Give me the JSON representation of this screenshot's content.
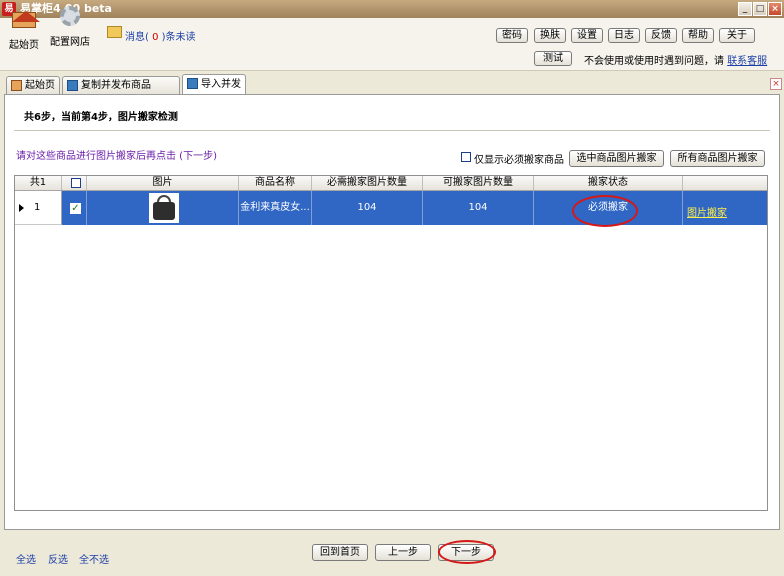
{
  "window": {
    "title": "易掌柜4.00 beta",
    "app_icon_glyph": "易"
  },
  "toolbar": {
    "home_label": "起始页",
    "config_label": "配置网店",
    "message": {
      "prefix": "消息(",
      "count": "0",
      "suffix": ")条未读"
    },
    "buttons": [
      "密码",
      "换肤",
      "设置",
      "日志",
      "反馈",
      "帮助",
      "关于"
    ],
    "test_label": "测试",
    "hint_text": "不会使用或使用时遇到问题，请",
    "hint_link": "联系客服"
  },
  "tabs": [
    {
      "label": "起始页",
      "icon": "home-icon"
    },
    {
      "label": "复制并发布商品",
      "icon": "grid-icon"
    },
    {
      "label": "导入并发布商品",
      "icon": "grid-icon",
      "active": true
    }
  ],
  "main": {
    "step_text": "共6步，当前第4步，图片搬家检测",
    "instruction": "请对这些商品进行图片搬家后再点击 (下一步)",
    "only_show_label": "仅显示必须搬家商品",
    "btn_selected": "选中商品图片搬家",
    "btn_all": "所有商品图片搬家"
  },
  "grid": {
    "headers": [
      "共1",
      "",
      "图片",
      "商品名称",
      "必需搬家图片数量",
      "可搬家图片数量",
      "搬家状态",
      ""
    ],
    "rows": [
      {
        "index": "1",
        "checked": true,
        "name": "金利来真皮女...",
        "required": "104",
        "movable": "104",
        "status": "必须搬家",
        "action": "图片搬家"
      }
    ]
  },
  "bottom": {
    "select_all": "全选",
    "invert": "反选",
    "select_none": "全不选",
    "btn_home": "回到首页",
    "btn_prev": "上一步",
    "btn_next": "下一步"
  },
  "colors": {
    "selection": "#3167c4",
    "highlight_oval": "#d51818",
    "link": "#1c3fa8"
  }
}
